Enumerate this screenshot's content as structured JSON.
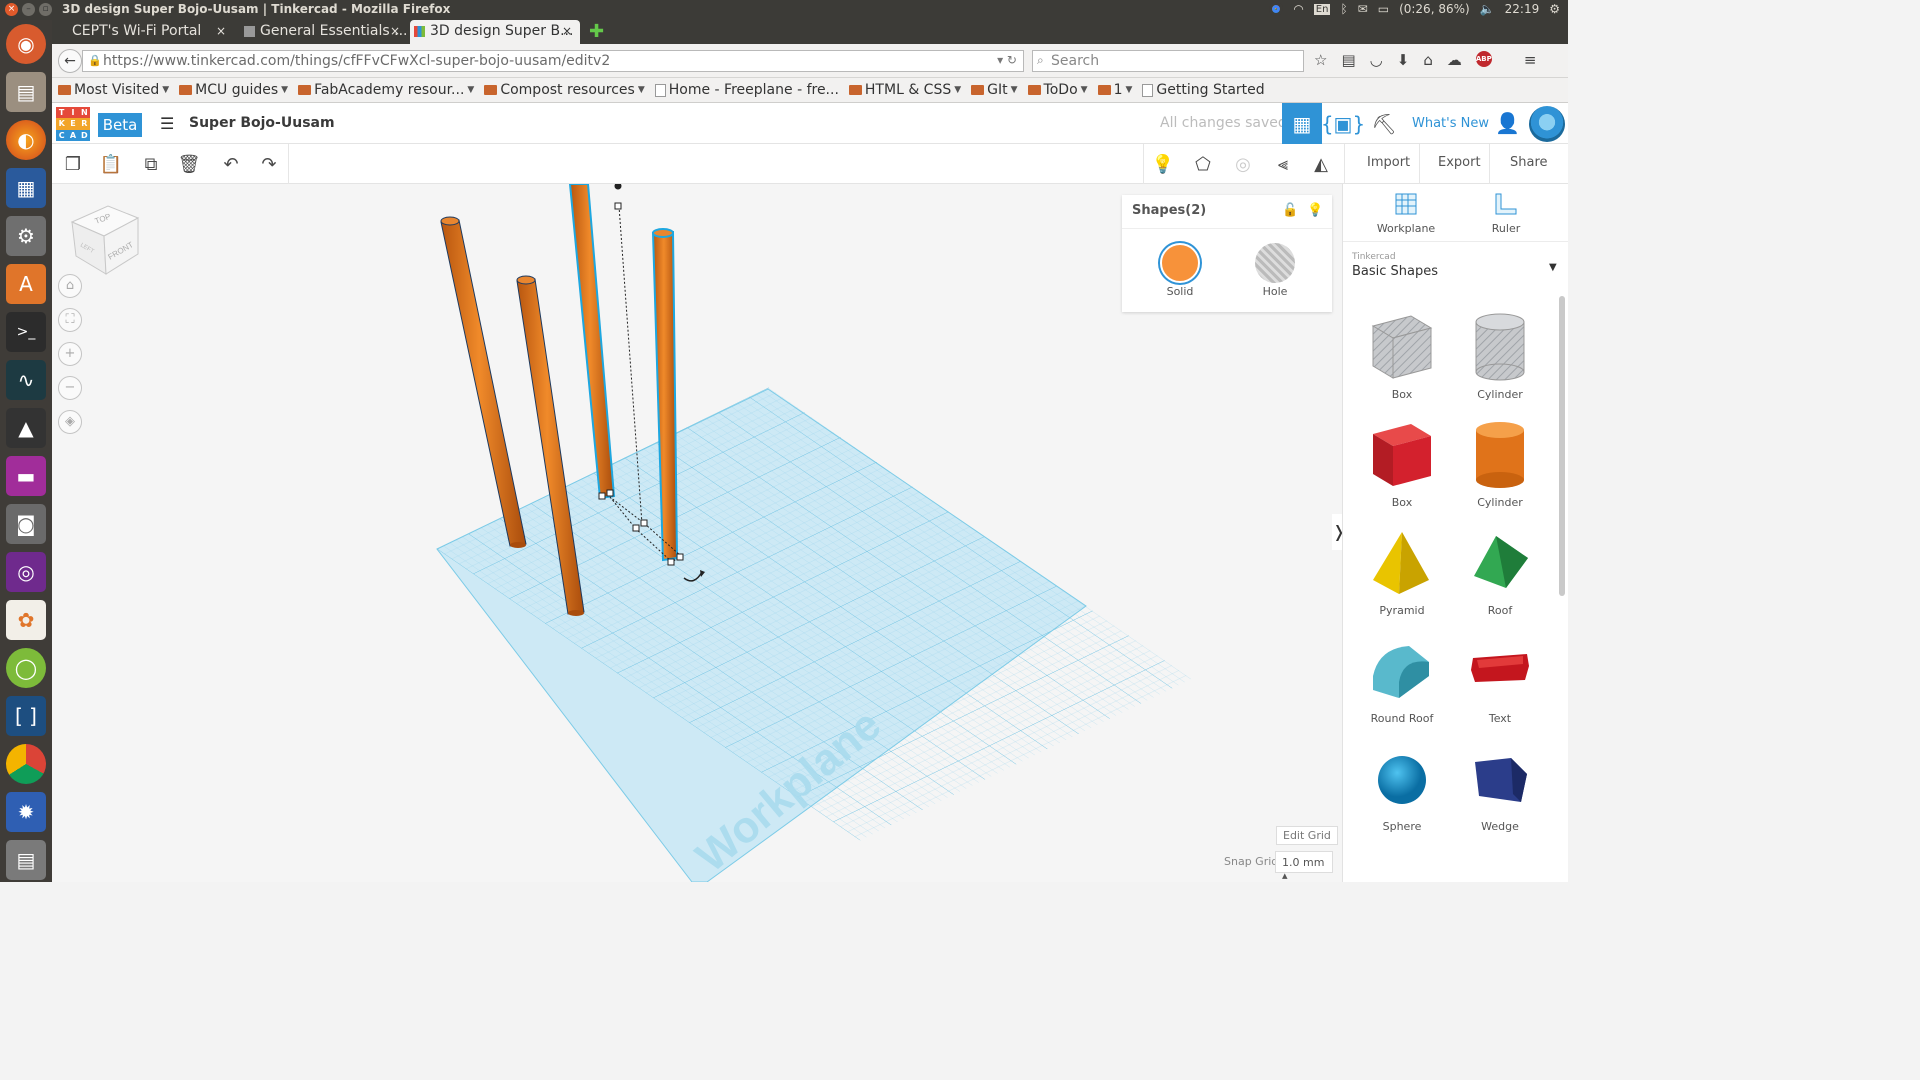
{
  "os": {
    "window_title": "3D design Super Bojo-Uusam | Tinkercad - Mozilla Firefox",
    "battery": "(0:26, 86%)",
    "keyboard": "En",
    "clock": "22:19"
  },
  "browser": {
    "tabs": [
      {
        "label": "CEPT's Wi-Fi Portal"
      },
      {
        "label": "General Essentials ..."
      },
      {
        "label": "3D design Super B..."
      }
    ],
    "url": "https://www.tinkercad.com/things/cfFFvCFwXcl-super-bojo-uusam/editv2",
    "search_placeholder": "Search",
    "abp_label": "ABP",
    "bookmarks": [
      {
        "label": "Most Visited",
        "type": "folder-menu"
      },
      {
        "label": "MCU guides",
        "type": "folder"
      },
      {
        "label": "FabAcademy resour...",
        "type": "folder"
      },
      {
        "label": "Compost resources",
        "type": "folder"
      },
      {
        "label": "Home - Freeplane - fre...",
        "type": "page"
      },
      {
        "label": "HTML & CSS",
        "type": "folder"
      },
      {
        "label": "GIt",
        "type": "folder"
      },
      {
        "label": "ToDo",
        "type": "folder"
      },
      {
        "label": "1",
        "type": "folder"
      },
      {
        "label": "Getting Started",
        "type": "page"
      }
    ]
  },
  "tinkercad": {
    "logo_letters": [
      "TIN",
      "KER",
      "CAD"
    ],
    "beta_label": "Beta",
    "design_name": "Super Bojo-Uusam",
    "save_status": "All changes saved",
    "whats_new": "What's New",
    "toolbar": {
      "import_label": "Import",
      "export_label": "Export",
      "share_label": "Share"
    },
    "viewcube": {
      "top": "TOP",
      "front": "FRONT",
      "left": "LEFT"
    },
    "workplane_watermark": "Workplane",
    "inspector": {
      "title": "Shapes(2)",
      "solid_label": "Solid",
      "hole_label": "Hole",
      "solid_color": "#f7923a"
    },
    "edit_grid_label": "Edit Grid",
    "snap_grid_label": "Snap Grid",
    "snap_grid_value": "1.0 mm ▴",
    "right_panel": {
      "workplane_label": "Workplane",
      "ruler_label": "Ruler",
      "source": "Tinkercad",
      "category": "Basic Shapes",
      "shapes": [
        {
          "label": "Box",
          "icon": "box-hole-icon"
        },
        {
          "label": "Cylinder",
          "icon": "cylinder-hole-icon"
        },
        {
          "label": "Box",
          "icon": "box-red-icon"
        },
        {
          "label": "Cylinder",
          "icon": "cylinder-orange-icon"
        },
        {
          "label": "Pyramid",
          "icon": "pyramid-icon"
        },
        {
          "label": "Roof",
          "icon": "roof-icon"
        },
        {
          "label": "Round Roof",
          "icon": "round-roof-icon"
        },
        {
          "label": "Text",
          "icon": "text-shape-icon"
        },
        {
          "label": "Sphere",
          "icon": "sphere-icon"
        },
        {
          "label": "Wedge",
          "icon": "wedge-icon"
        }
      ]
    },
    "colors": {
      "accent": "#2f93d6",
      "workplane": "#c9e8f4",
      "rod": "#e57c22"
    }
  }
}
